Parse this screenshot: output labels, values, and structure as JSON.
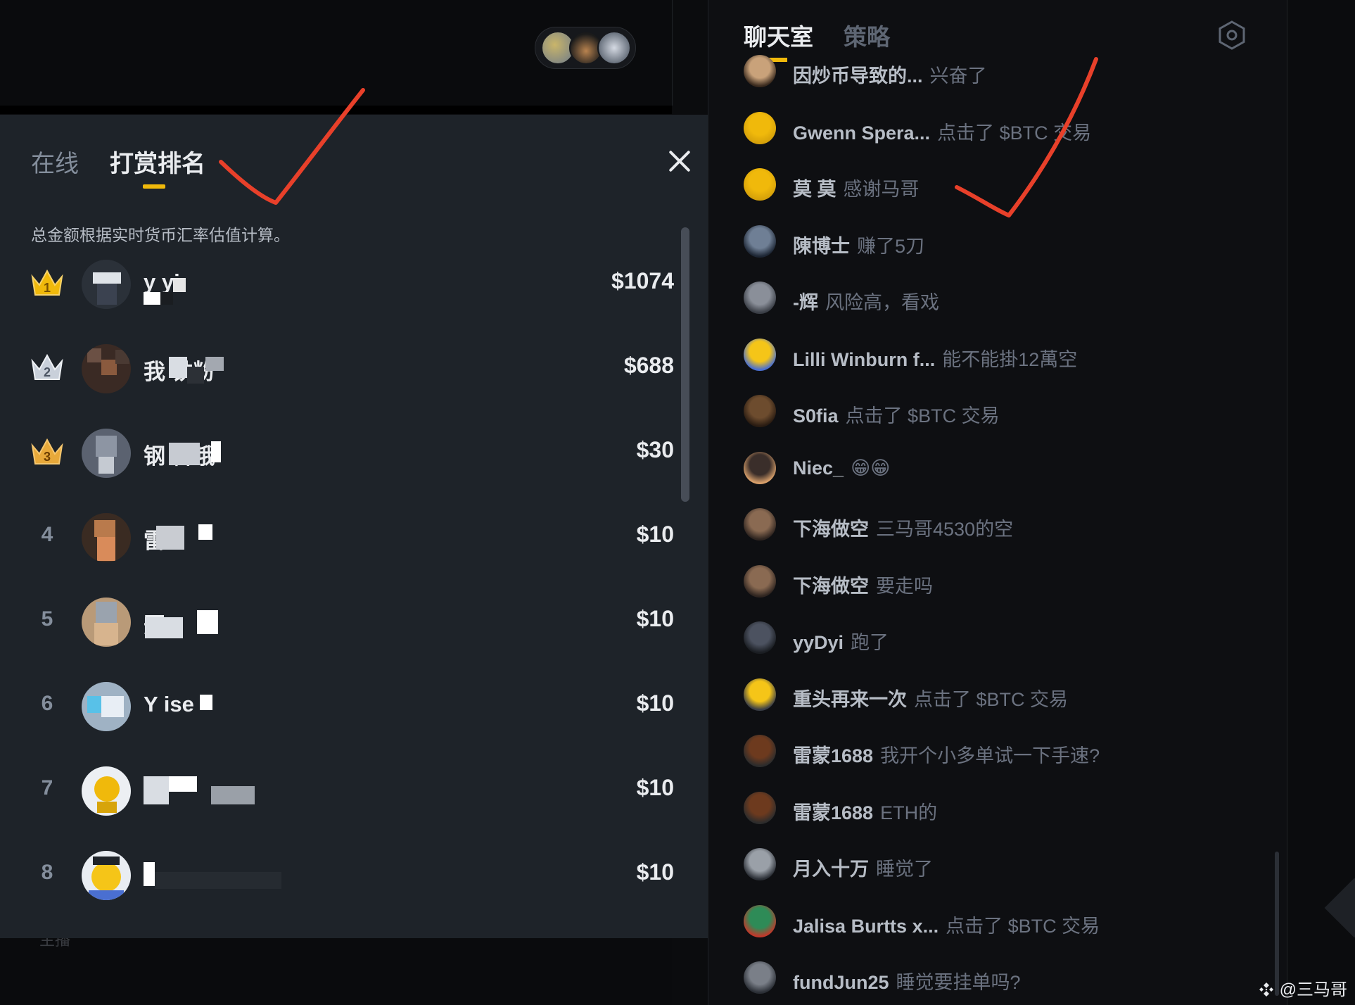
{
  "ranking_panel": {
    "tab_online": "在线",
    "tab_ranking": "打赏排名",
    "note": "总金额根据实时货币汇率估值计算。",
    "rows": [
      {
        "rank": "1",
        "name": "y  yi",
        "amount": "$1074"
      },
      {
        "rank": "2",
        "name": "我     铁粉",
        "amount": "$688"
      },
      {
        "rank": "3",
        "name": "钢      鲁哦",
        "amount": "$30"
      },
      {
        "rank": "4",
        "name": "雷       8",
        "amount": "$10"
      },
      {
        "rank": "5",
        "name": "       开_",
        "amount": "$10"
      },
      {
        "rank": "6",
        "name": "Y      ise",
        "amount": "$10"
      },
      {
        "rank": "7",
        "name": "",
        "amount": "$10"
      },
      {
        "rank": "8",
        "name": "",
        "amount": "$10"
      }
    ]
  },
  "left_bottom_hint": "主播",
  "chat": {
    "tab_room": "聊天室",
    "tab_strategy": "策略",
    "messages": [
      {
        "user": "因炒币导致的...",
        "text": "兴奋了"
      },
      {
        "user": "Gwenn Spera...",
        "text": "点击了 $BTC 交易"
      },
      {
        "user": "莫 莫",
        "text": "感谢马哥"
      },
      {
        "user": "陳博士",
        "text": "赚了5刀"
      },
      {
        "user": "-辉",
        "text": "风险高，看戏"
      },
      {
        "user": "Lilli Winburn f...",
        "text": "能不能掛12萬空"
      },
      {
        "user": "S0fia",
        "text": "点击了 $BTC 交易"
      },
      {
        "user": "Niec_",
        "text": "😁😁"
      },
      {
        "user": "下海做空",
        "text": "三马哥4530的空"
      },
      {
        "user": "下海做空",
        "text": "要走吗"
      },
      {
        "user": "yyDyi",
        "text": "跑了"
      },
      {
        "user": "重头再来一次",
        "text": "点击了 $BTC 交易"
      },
      {
        "user": "雷蒙1688",
        "text": "我开个小多单试一下手速?"
      },
      {
        "user": "雷蒙1688",
        "text": "ETH的"
      },
      {
        "user": "月入十万",
        "text": "睡觉了"
      },
      {
        "user": "Jalisa Burtts x...",
        "text": "点击了 $BTC 交易"
      },
      {
        "user": "fundJun25",
        "text": "睡觉要挂单吗?"
      }
    ]
  },
  "watermark": "@三马哥",
  "colors": {
    "accent": "#f0b90b",
    "panel_bg": "#1e2329",
    "annotation_red": "#e8402a"
  },
  "icons": [
    "crown-gold-icon",
    "crown-silver-icon",
    "crown-bronze-icon",
    "close-icon",
    "settings-hexagon-icon",
    "binance-logo-icon"
  ]
}
